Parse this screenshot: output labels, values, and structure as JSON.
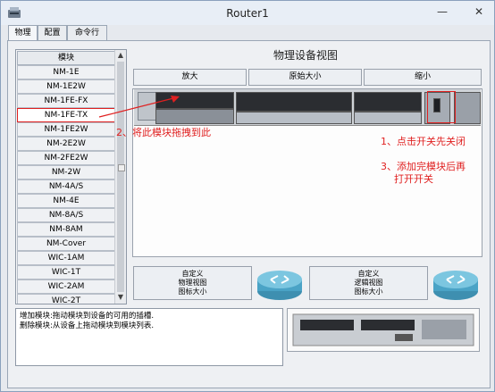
{
  "window": {
    "title": "Router1"
  },
  "tabs": [
    {
      "label": "物理"
    },
    {
      "label": "配置"
    },
    {
      "label": "命令行"
    }
  ],
  "module_list": {
    "header": "模块",
    "items": [
      {
        "label": "NM-1E"
      },
      {
        "label": "NM-1E2W"
      },
      {
        "label": "NM-1FE-FX"
      },
      {
        "label": "NM-1FE-TX"
      },
      {
        "label": "NM-1FE2W"
      },
      {
        "label": "NM-2E2W"
      },
      {
        "label": "NM-2FE2W"
      },
      {
        "label": "NM-2W"
      },
      {
        "label": "NM-4A/S"
      },
      {
        "label": "NM-4E"
      },
      {
        "label": "NM-8A/S"
      },
      {
        "label": "NM-8AM"
      },
      {
        "label": "NM-Cover"
      },
      {
        "label": "WIC-1AM"
      },
      {
        "label": "WIC-1T"
      },
      {
        "label": "WIC-2AM"
      },
      {
        "label": "WIC-2T"
      }
    ]
  },
  "physical_view": {
    "title": "物理设备视图",
    "zoom_in": "放大",
    "original_size": "原始大小",
    "zoom_out": "缩小"
  },
  "annotations": {
    "drag_note": "2、将此模块拖拽到此",
    "power_off_note": "1、点击开关先关闭",
    "power_on_note_line1": "3、添加完模块后再",
    "power_on_note_line2": "打开开关"
  },
  "custom_buttons": {
    "physical": {
      "line1": "自定义",
      "line2": "物理视图",
      "line3": "图标大小"
    },
    "logical": {
      "line1": "自定义",
      "line2": "逻辑视图",
      "line3": "图标大小"
    }
  },
  "description": {
    "line1": "增加模块:拖动模块到设备的可用的插槽.",
    "line2": "删除模块:从设备上拖动模块到模块列表."
  },
  "colors": {
    "annotation": "#e02020",
    "window_bg": "#e6e9ee"
  }
}
